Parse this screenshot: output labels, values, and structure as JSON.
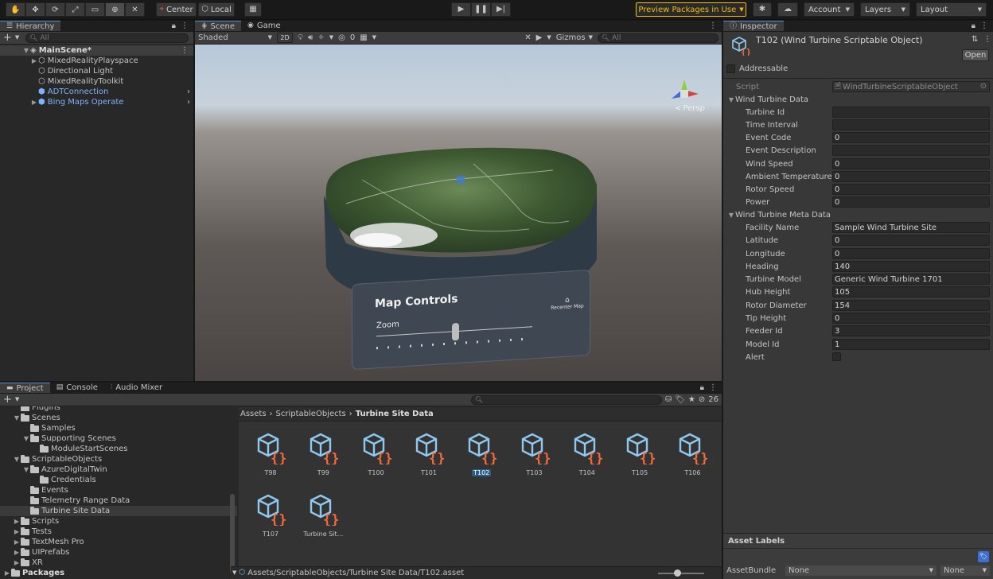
{
  "toolbar": {
    "pivot_label": "Center",
    "space_label": "Local",
    "preview_packages_label": "Preview Packages in Use",
    "account_label": "Account",
    "layers_label": "Layers",
    "layout_label": "Layout",
    "accent_color": "#f4bc02"
  },
  "hierarchy": {
    "tab_label": "Hierarchy",
    "search_placeholder": "All",
    "scene_name": "MainScene*",
    "items": [
      {
        "label": "MixedRealityPlayspace",
        "has_children": true,
        "prefab": false
      },
      {
        "label": "Directional Light",
        "has_children": false,
        "prefab": false
      },
      {
        "label": "MixedRealityToolkit",
        "has_children": false,
        "prefab": false
      },
      {
        "label": "ADTConnection",
        "has_children": false,
        "prefab": true
      },
      {
        "label": "Bing Maps Operate",
        "has_children": true,
        "prefab": true
      }
    ]
  },
  "scene": {
    "tabs": [
      "Scene",
      "Game"
    ],
    "shading_mode": "Shaded",
    "mode_2d": "2D",
    "hidden_count": "0",
    "gizmos_label": "Gizmos",
    "search_placeholder": "All",
    "persp_label": "Persp",
    "map_controls": {
      "title": "Map Controls",
      "zoom_label": "Zoom",
      "recenter_label": "Recenter Map"
    }
  },
  "inspector": {
    "tab_label": "Inspector",
    "title": "T102 (Wind Turbine Scriptable Object)",
    "open_label": "Open",
    "addressable_label": "Addressable",
    "script_label": "Script",
    "script_value": "WindTurbineScriptableObject",
    "section1": "Wind Turbine Data",
    "section2": "Wind Turbine Meta Data",
    "data_fields": [
      {
        "label": "Turbine Id",
        "value": ""
      },
      {
        "label": "Time Interval",
        "value": ""
      },
      {
        "label": "Event Code",
        "value": "0"
      },
      {
        "label": "Event Description",
        "value": ""
      },
      {
        "label": "Wind Speed",
        "value": "0"
      },
      {
        "label": "Ambient Temperature",
        "value": "0"
      },
      {
        "label": "Rotor Speed",
        "value": "0"
      },
      {
        "label": "Power",
        "value": "0"
      }
    ],
    "meta_fields": [
      {
        "label": "Facility Name",
        "value": "Sample Wind Turbine Site"
      },
      {
        "label": "Latitude",
        "value": "0"
      },
      {
        "label": "Longitude",
        "value": "0"
      },
      {
        "label": "Heading",
        "value": "140"
      },
      {
        "label": "Turbine Model",
        "value": "Generic Wind Turbine 1701"
      },
      {
        "label": "Hub Height",
        "value": "105"
      },
      {
        "label": "Rotor Diameter",
        "value": "154"
      },
      {
        "label": "Tip Height",
        "value": "0"
      },
      {
        "label": "Feeder Id",
        "value": "3"
      },
      {
        "label": "Model Id",
        "value": "1"
      }
    ],
    "alert_label": "Alert",
    "asset_labels_title": "Asset Labels",
    "assetbundle_label": "AssetBundle",
    "assetbundle_value": "None",
    "assetbundle_variant": "None"
  },
  "project": {
    "tabs": [
      "Project",
      "Console",
      "Audio Mixer"
    ],
    "hidden_count": "26",
    "breadcrumb": [
      "Assets",
      "ScriptableObjects",
      "Turbine Site Data"
    ],
    "tree": [
      {
        "label": "Plugins",
        "depth": 1,
        "caret": "",
        "cut": true
      },
      {
        "label": "Scenes",
        "depth": 1,
        "caret": "▼"
      },
      {
        "label": "Samples",
        "depth": 2,
        "caret": ""
      },
      {
        "label": "Supporting Scenes",
        "depth": 2,
        "caret": "▼"
      },
      {
        "label": "ModuleStartScenes",
        "depth": 3,
        "caret": ""
      },
      {
        "label": "ScriptableObjects",
        "depth": 1,
        "caret": "▼"
      },
      {
        "label": "AzureDigitalTwin",
        "depth": 2,
        "caret": "▼"
      },
      {
        "label": "Credentials",
        "depth": 3,
        "caret": ""
      },
      {
        "label": "Events",
        "depth": 2,
        "caret": ""
      },
      {
        "label": "Telemetry Range Data",
        "depth": 2,
        "caret": ""
      },
      {
        "label": "Turbine Site Data",
        "depth": 2,
        "caret": "",
        "selected": true
      },
      {
        "label": "Scripts",
        "depth": 1,
        "caret": "▶"
      },
      {
        "label": "Tests",
        "depth": 1,
        "caret": "▶"
      },
      {
        "label": "TextMesh Pro",
        "depth": 1,
        "caret": "▶"
      },
      {
        "label": "UIPrefabs",
        "depth": 1,
        "caret": "▶"
      },
      {
        "label": "XR",
        "depth": 1,
        "caret": "▶"
      },
      {
        "label": "Packages",
        "depth": 0,
        "caret": "▶",
        "bold": true
      }
    ],
    "assets": [
      "T98",
      "T99",
      "T100",
      "T101",
      "T102",
      "T103",
      "T104",
      "T105",
      "T106",
      "T107",
      "Turbine Sit..."
    ],
    "selected_asset": "T102",
    "status_path": "Assets/ScriptableObjects/Turbine Site Data/T102.asset"
  }
}
